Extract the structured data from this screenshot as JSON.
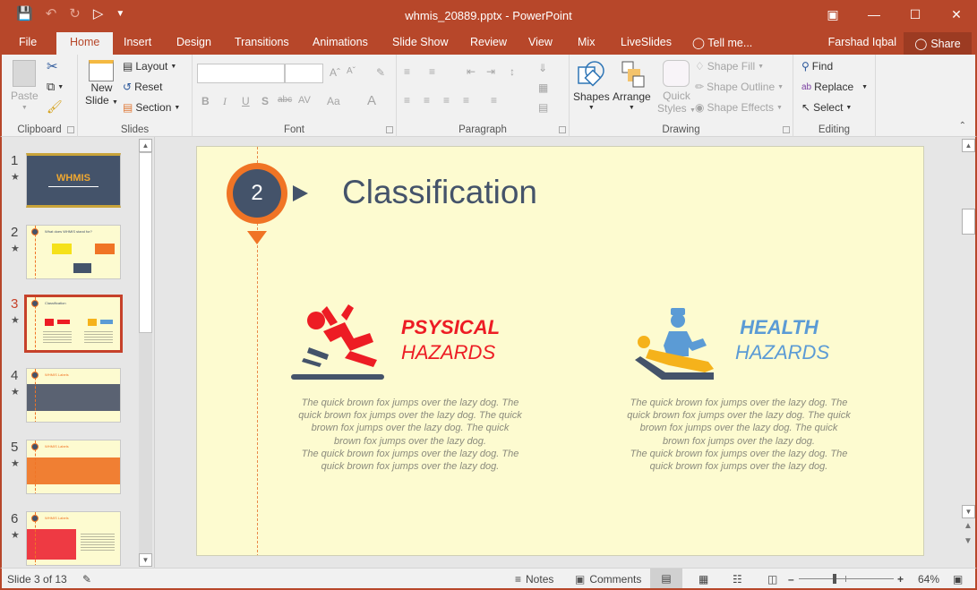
{
  "window": {
    "title": "whmis_20889.pptx - PowerPoint",
    "quick_access": [
      "save-icon",
      "undo-icon",
      "redo-icon",
      "present-from-start-icon",
      "customize-qat-icon"
    ],
    "controls": [
      "ribbon-display-options",
      "minimize",
      "maximize",
      "close"
    ]
  },
  "tabs": [
    {
      "label": "File"
    },
    {
      "label": "Home",
      "active": true
    },
    {
      "label": "Insert"
    },
    {
      "label": "Design"
    },
    {
      "label": "Transitions"
    },
    {
      "label": "Animations"
    },
    {
      "label": "Slide Show"
    },
    {
      "label": "Review"
    },
    {
      "label": "View"
    },
    {
      "label": "Mix"
    },
    {
      "label": "LiveSlides"
    }
  ],
  "tell_me": "Tell me...",
  "user_name": "Farshad Iqbal",
  "share_label": "Share",
  "ribbon": {
    "clipboard": {
      "label": "Clipboard",
      "paste": "Paste"
    },
    "slides": {
      "label": "Slides",
      "new_slide_1": "New",
      "new_slide_2": "Slide",
      "layout": "Layout",
      "reset": "Reset",
      "section": "Section"
    },
    "font": {
      "label": "Font",
      "font_name": "",
      "font_size": "",
      "bold": "B",
      "italic": "I",
      "underline": "U",
      "shadow": "S",
      "strike": "abc",
      "spacing": "AV",
      "case": "Aa",
      "color": "A"
    },
    "paragraph": {
      "label": "Paragraph"
    },
    "drawing": {
      "label": "Drawing",
      "shapes": "Shapes",
      "arrange": "Arrange",
      "quick_styles_1": "Quick",
      "quick_styles_2": "Styles",
      "shape_fill": "Shape Fill",
      "shape_outline": "Shape Outline",
      "shape_effects": "Shape Effects"
    },
    "editing": {
      "label": "Editing",
      "find": "Find",
      "replace": "Replace",
      "select": "Select"
    }
  },
  "thumbnails": [
    {
      "num": "1",
      "title": "WHMIS",
      "theme": "dark"
    },
    {
      "num": "2",
      "title": "What does WHMIS stand for?",
      "theme": "light"
    },
    {
      "num": "3",
      "title": "Classification",
      "theme": "light",
      "selected": true
    },
    {
      "num": "4",
      "title": "WHMIS Labels",
      "theme": "gray-band"
    },
    {
      "num": "5",
      "title": "WHMIS Labels",
      "theme": "orange-band"
    },
    {
      "num": "6",
      "title": "WHMIS Labels",
      "theme": "red-band"
    }
  ],
  "slide": {
    "number": "2",
    "title": "Classification",
    "hazards": [
      {
        "line1": "PSYSICAL",
        "line2": "HAZARDS",
        "color": "#ed1c24",
        "icon": "slip-fall-icon",
        "text": [
          "The quick brown fox jumps over the lazy dog. The",
          "quick brown fox jumps over the lazy dog. The quick",
          "brown fox jumps over the lazy dog. The quick",
          "brown fox jumps over the lazy dog.",
          "The quick brown fox jumps over the lazy dog. The",
          "quick brown fox jumps over the lazy dog."
        ]
      },
      {
        "line1": "HEALTH",
        "line2": "HAZARDS",
        "color": "#5b9bd5",
        "icon": "doctor-patient-icon",
        "text": [
          "The quick brown fox jumps over the lazy dog. The",
          "quick brown fox jumps over the lazy dog. The quick",
          "brown fox jumps over the lazy dog. The quick",
          "brown fox jumps over the lazy dog.",
          "The quick brown fox jumps over the lazy dog. The",
          "quick brown fox jumps over the lazy dog."
        ]
      }
    ]
  },
  "status": {
    "slide_info": "Slide 3 of 13",
    "notes": "Notes",
    "comments": "Comments",
    "zoom": "64%",
    "zoom_fraction": 0.5
  },
  "colors": {
    "accent": "#b7472a",
    "slide_bg": "#fdfbd0",
    "badge_orange": "#f07425",
    "navy": "#44536a"
  }
}
